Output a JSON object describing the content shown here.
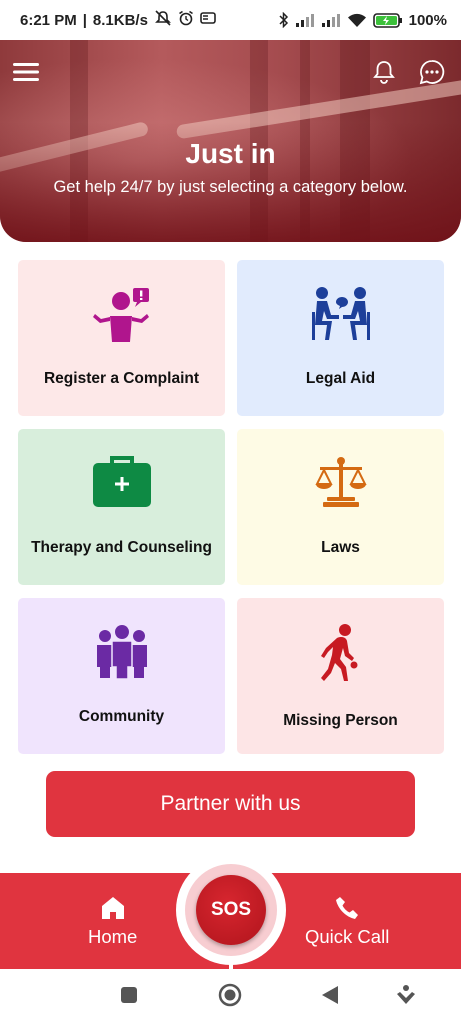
{
  "status_bar": {
    "time": "6:21 PM",
    "network_speed": "8.1KB/s",
    "battery": "100"
  },
  "hero": {
    "title": "Just in",
    "subtitle": "Get help 24/7 by just selecting a category below."
  },
  "categories": [
    {
      "label": "Register a Complaint",
      "icon": "complaint-person-icon",
      "bg": "#fde8e8"
    },
    {
      "label": "Legal Aid",
      "icon": "consultation-icon",
      "bg": "#e1ebfd"
    },
    {
      "label": "Therapy and Counseling",
      "icon": "first-aid-kit-icon",
      "bg": "#d8eedc"
    },
    {
      "label": "Laws",
      "icon": "scales-icon",
      "bg": "#fefbe5"
    },
    {
      "label": "Community",
      "icon": "group-people-icon",
      "bg": "#f0e4fd"
    },
    {
      "label": "Missing Person",
      "icon": "walking-person-icon",
      "bg": "#fde5e6"
    }
  ],
  "partner_button": "Partner with us",
  "bottom_nav": {
    "home": "Home",
    "sos": "SOS",
    "quick_call": "Quick Call"
  },
  "colors": {
    "accent": "#e0343f",
    "sos": "#c01c24"
  }
}
